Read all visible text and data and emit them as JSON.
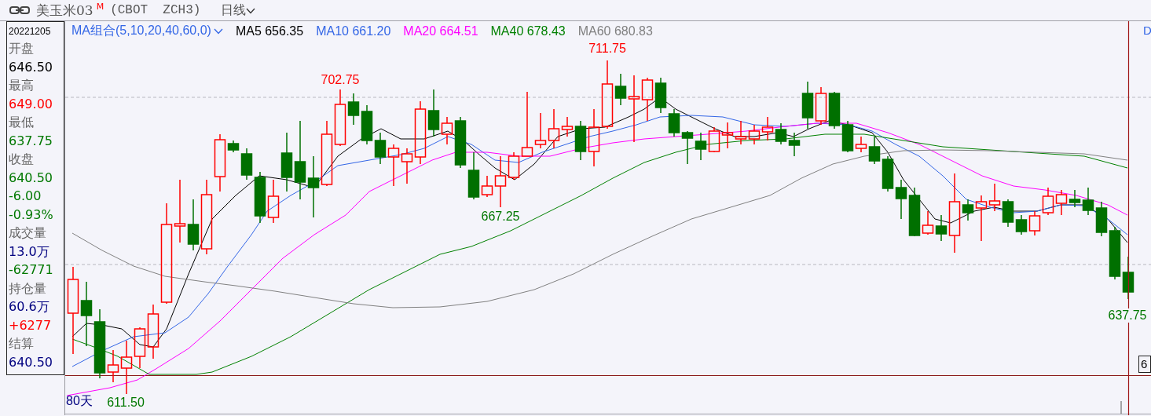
{
  "header": {
    "title": "美玉米03$^{M}$",
    "code": "(CBOT  ZCH3)",
    "period": "日线"
  },
  "info_panel": {
    "date": "20221205",
    "rows": [
      {
        "kind": "label",
        "text": "开盘"
      },
      {
        "kind": "value",
        "color": "#000000",
        "text": "646.50"
      },
      {
        "kind": "label",
        "text": "最高"
      },
      {
        "kind": "value",
        "color": "#ff0000",
        "text": "649.00"
      },
      {
        "kind": "label",
        "text": "最低"
      },
      {
        "kind": "value",
        "color": "#007800",
        "text": "637.75"
      },
      {
        "kind": "label",
        "text": "收盘"
      },
      {
        "kind": "value",
        "color": "#007800",
        "text": "640.50"
      },
      {
        "kind": "value",
        "color": "#007800",
        "text": "-6.00"
      },
      {
        "kind": "value",
        "color": "#007800",
        "text": "-0.93%"
      },
      {
        "kind": "label",
        "text": "成交量"
      },
      {
        "kind": "value",
        "color": "#000080",
        "text": "13.0万"
      },
      {
        "kind": "value",
        "color": "#007800",
        "text": "-62771"
      },
      {
        "kind": "label",
        "text": "持仓量"
      },
      {
        "kind": "value",
        "color": "#000080",
        "text": "60.6万"
      },
      {
        "kind": "value",
        "color": "#ff0000",
        "text": "+6277"
      },
      {
        "kind": "label",
        "text": "结算"
      },
      {
        "kind": "value",
        "color": "#000080",
        "text": "640.50"
      }
    ]
  },
  "legend": {
    "title": "MA组合(5,10,20,40,60,0)",
    "items": [
      {
        "text": "MA5 656.35",
        "color": "#000000"
      },
      {
        "text": "MA10 661.20",
        "color": "#3366e6"
      },
      {
        "text": "MA20 664.51",
        "color": "#ff00ff"
      },
      {
        "text": "MA40 678.43",
        "color": "#008000"
      },
      {
        "text": "MA60 680.83",
        "color": "#808080"
      }
    ]
  },
  "price_labels": [
    {
      "text": "702.75",
      "color": "#ff0000"
    },
    {
      "text": "711.75",
      "color": "#ff0000"
    },
    {
      "text": "667.25",
      "color": "#007800"
    },
    {
      "text": "611.50",
      "color": "#007800"
    },
    {
      "text": "637.75",
      "color": "#007800"
    }
  ],
  "range_label": "80天",
  "right_edge": {
    "legend_fragment": "D",
    "price_tag": "6"
  }
}
